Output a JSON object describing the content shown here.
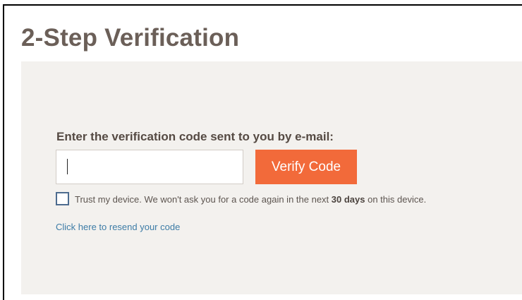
{
  "page": {
    "title": "2-Step Verification"
  },
  "form": {
    "prompt": "Enter the verification code sent to you by e-mail:",
    "code_value": "",
    "code_placeholder": "",
    "verify_label": "Verify Code",
    "trust": {
      "checked": false,
      "text_before": "Trust my device. We won't ask you for a code again in the next ",
      "text_bold": "30 days",
      "text_after": " on this device."
    },
    "resend_link": "Click here to resend your code"
  },
  "colors": {
    "title": "#6b5f58",
    "panel_background": "#f3f1ee",
    "button_background": "#f26a3a",
    "link": "#3d7ca6",
    "checkbox_border": "#4d6c8f"
  },
  "icons": {
    "checkbox": "checkbox-unchecked-icon"
  }
}
